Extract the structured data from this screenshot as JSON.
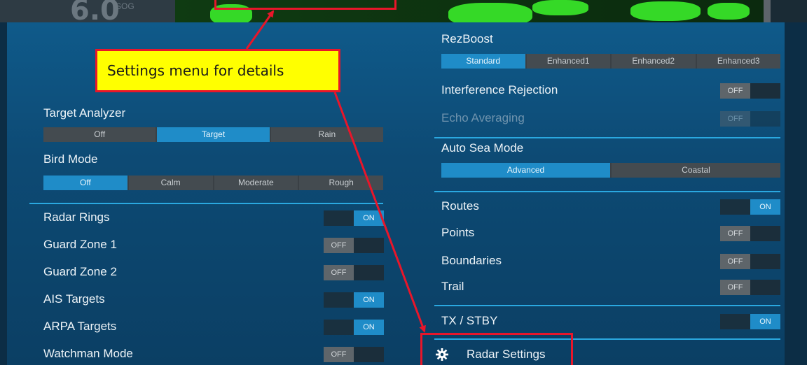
{
  "background": {
    "sog_value": "6.0",
    "sog_label": "SOG"
  },
  "callout": {
    "text": "Settings menu for details"
  },
  "left": {
    "target_analyzer": {
      "title": "Target Analyzer",
      "options": [
        "Off",
        "Target",
        "Rain"
      ],
      "selected": "Target"
    },
    "bird_mode": {
      "title": "Bird Mode",
      "options": [
        "Off",
        "Calm",
        "Moderate",
        "Rough"
      ],
      "selected": "Off"
    },
    "toggles": [
      {
        "label": "Radar Rings",
        "state": "ON"
      },
      {
        "label": "Guard Zone 1",
        "state": "OFF"
      },
      {
        "label": "Guard Zone 2",
        "state": "OFF"
      },
      {
        "label": "AIS Targets",
        "state": "ON"
      },
      {
        "label": "ARPA Targets",
        "state": "ON"
      },
      {
        "label": "Watchman Mode",
        "state": "OFF"
      }
    ]
  },
  "right": {
    "rezboost": {
      "title": "RezBoost",
      "options": [
        "Standard",
        "Enhanced1",
        "Enhanced2",
        "Enhanced3"
      ],
      "selected": "Standard"
    },
    "interference_rejection": {
      "label": "Interference Rejection",
      "state": "OFF"
    },
    "echo_averaging": {
      "label": "Echo Averaging",
      "state": "OFF"
    },
    "auto_sea_mode": {
      "title": "Auto Sea Mode",
      "options": [
        "Advanced",
        "Coastal"
      ],
      "selected": "Advanced"
    },
    "toggles": [
      {
        "label": "Routes",
        "state": "ON"
      },
      {
        "label": "Points",
        "state": "OFF"
      },
      {
        "label": "Boundaries",
        "state": "OFF"
      },
      {
        "label": "Trail",
        "state": "OFF"
      }
    ],
    "tx_stby": {
      "label": "TX / STBY",
      "state": "ON"
    },
    "radar_settings": {
      "label": "Radar Settings",
      "icon": "gear-icon"
    }
  },
  "colors": {
    "accent": "#1f8cc8",
    "highlight_box": "#e8162a",
    "callout_fill": "#ffff00"
  }
}
